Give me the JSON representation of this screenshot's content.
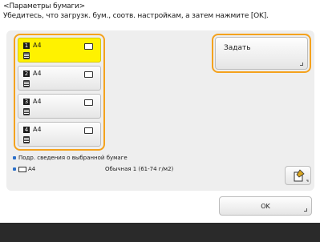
{
  "header": {
    "title": "<Параметры бумаги>",
    "instruction": "Убедитесь, что загрузк. бум., соотв. настройкам, а затем нажмите [OK]."
  },
  "drawers": [
    {
      "number": "1",
      "size": "A4",
      "selected": true
    },
    {
      "number": "2",
      "size": "A4",
      "selected": false
    },
    {
      "number": "3",
      "size": "A4",
      "selected": false
    },
    {
      "number": "4",
      "size": "A4",
      "selected": false
    }
  ],
  "set_button": {
    "label": "Задать"
  },
  "info": {
    "details_label": "Подр. сведения о выбранной бумаге",
    "paper_size": "A4",
    "paper_type": "Обычная 1 (61-74 г/м2)"
  },
  "ok_button": {
    "label": "OK"
  },
  "colors": {
    "highlight": "#f4a21d",
    "selected": "#fff200",
    "bullet": "#2a6fc9",
    "footer": "#2a2a2a"
  }
}
